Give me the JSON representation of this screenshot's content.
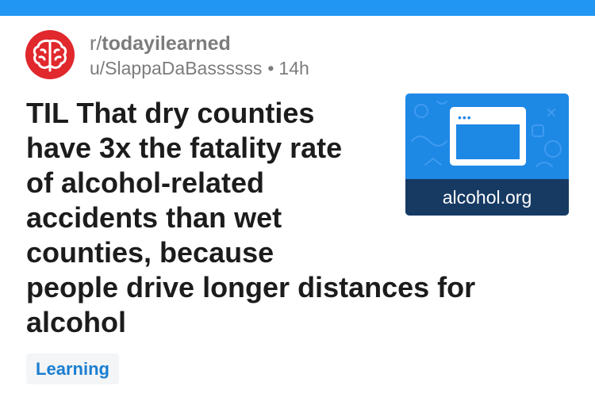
{
  "colors": {
    "top_bar": "#2196f3",
    "avatar_bg": "#e0282d",
    "thumbnail_bg": "#1e88e5",
    "thumbnail_caption_bg": "#173a63",
    "flair_text": "#1a7ed1",
    "meta_text": "#7c7c7c",
    "title_text": "#1c1c1c"
  },
  "post": {
    "subreddit_prefix": "r/",
    "subreddit_name": "todayilearned",
    "author": "u/SlappaDaBassssss",
    "separator": "•",
    "age": "14h",
    "avatar_icon": "brain-icon",
    "title_lines": [
      "TIL That dry counties",
      "have 3x the fatality rate",
      "of alcohol-related",
      "accidents than wet",
      "counties, because",
      "people drive longer distances for",
      "alcohol"
    ],
    "thumbnail": {
      "icon": "browser-window-icon",
      "dots": "•••",
      "domain": "alcohol.org"
    },
    "flair": "Learning"
  }
}
